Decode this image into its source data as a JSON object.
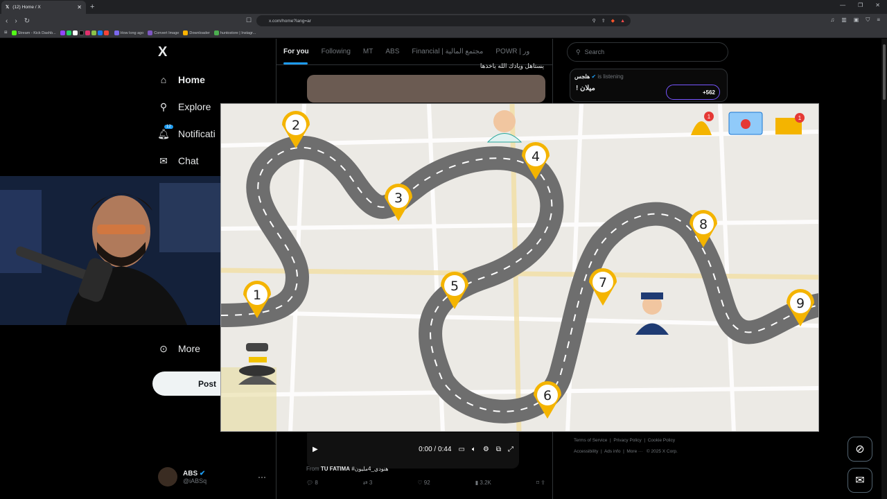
{
  "browser": {
    "tab_title": "(12) Home / X",
    "url": "x.com/home?lang=ar",
    "bookmarks": [
      "Stream - Kick Dashb...",
      "How long ago",
      "Convert Image",
      "Downloader",
      "huntostore | Instagr..."
    ]
  },
  "sidebar": {
    "logo": "X",
    "items": [
      {
        "label": "Home",
        "icon": "home-icon"
      },
      {
        "label": "Explore",
        "icon": "search-icon"
      },
      {
        "label": "Notificati",
        "icon": "bell-icon",
        "badge": "12"
      },
      {
        "label": "Chat",
        "icon": "mail-icon"
      },
      {
        "label": "More",
        "icon": "more-circle-icon"
      }
    ],
    "post_label": "Post",
    "profile": {
      "name": "ABS",
      "handle": "@iABSq"
    }
  },
  "feed": {
    "tabs": [
      "For you",
      "Following",
      "MT",
      "ABS",
      "Financial | مجتمع المالية",
      "POWR | ور"
    ],
    "tweet_text": "يستاهل ويادك الله ياخذها",
    "video": {
      "time": "0:00 / 0:44"
    },
    "from": "From",
    "from_name": "TU FATIMA",
    "hashtag": "#هنودي_4مليون",
    "stats": {
      "replies": "8",
      "reposts": "3",
      "likes": "92",
      "views": "3.2K"
    }
  },
  "right": {
    "search_placeholder": "Search",
    "space": {
      "host": "هلجس",
      "status": "is listening",
      "title": "! ميلان",
      "listeners": "+562"
    },
    "footer": [
      "Terms of Service",
      "Privacy Policy",
      "Cookie Policy",
      "Accessibility",
      "Ads info",
      "More ···",
      "© 2025 X Corp."
    ]
  },
  "overlay_map": {
    "pins": [
      "1",
      "2",
      "3",
      "4",
      "5",
      "6",
      "7",
      "8",
      "9"
    ],
    "notif_count": "1",
    "mail_count": "1"
  },
  "colors": {
    "accent": "#1d9bf0",
    "pin": "#f4b400",
    "road": "#6e6e6e"
  }
}
